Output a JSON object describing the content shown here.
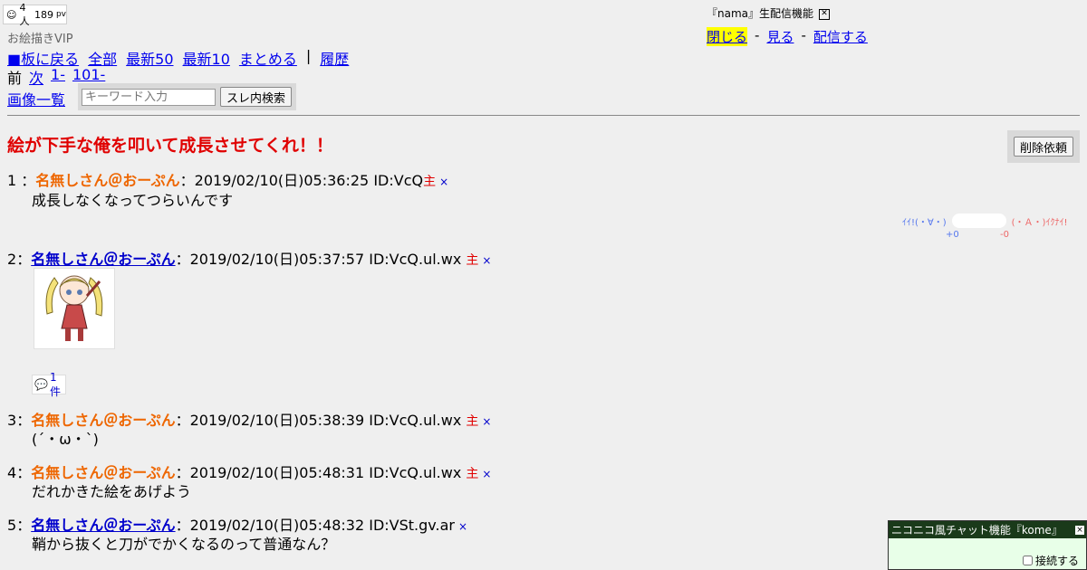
{
  "stats": {
    "count": "4人",
    "views": "189",
    "pv": "pv"
  },
  "board_name": "お絵描きVIP",
  "nav": {
    "back": "■板に戻る",
    "all": "全部",
    "latest50": "最新50",
    "latest10": "最新10",
    "summary": "まとめる",
    "separator": "|",
    "history": "履歴",
    "prev": "前",
    "next": "次",
    "range1": "1-",
    "range2": "101-",
    "images": "画像一覧"
  },
  "search": {
    "placeholder": "キーワード入力",
    "button": "スレ内検索"
  },
  "nama": {
    "title": "『nama』生配信機能",
    "close": "閉じる",
    "watch": "見る",
    "broadcast": "配信する",
    "dash": "-"
  },
  "thread_title": "絵が下手な俺を叩いて成長させてくれ！！",
  "delete_request": "削除依頼",
  "vote": {
    "good": "ｲｲ!(・∀・)",
    "bad": "(・Ａ・)ｲｸﾅｲ!",
    "plus": "+0",
    "minus": "-0"
  },
  "posts": [
    {
      "num": "1",
      "sep": "：",
      "name": "名無しさん＠おーぷん",
      "date": "：2019/02/10(日)05:36:25 ID:VcQ",
      "owner": "主",
      "x": "×",
      "body": "成長しなくなってつらいんです"
    },
    {
      "num": "2",
      "sep": "：",
      "name": "名無しさん＠おーぷん",
      "date": "：2019/02/10(日)05:37:57 ID:VcQ.ul.wx",
      "owner": "主",
      "x": "×",
      "replies": "1件"
    },
    {
      "num": "3",
      "sep": "：",
      "name": "名無しさん＠おーぷん",
      "date": "：2019/02/10(日)05:38:39 ID:VcQ.ul.wx",
      "owner": "主",
      "x": "×",
      "body": "(´・ω・`)"
    },
    {
      "num": "4",
      "sep": "：",
      "name": "名無しさん＠おーぷん",
      "date": "：2019/02/10(日)05:48:31 ID:VcQ.ul.wx",
      "owner": "主",
      "x": "×",
      "body": "だれかきた絵をあげよう"
    },
    {
      "num": "5",
      "sep": "：",
      "name": "名無しさん＠おーぷん",
      "date": "：2019/02/10(日)05:48:32 ID:VSt.gv.ar",
      "x": "×",
      "body": "鞘から抜くと刀がでかくなるのって普通なん？"
    }
  ],
  "chat": {
    "title": "ニコニコ風チャット機能『kome』",
    "close": "×",
    "connect": "接続する"
  },
  "colors": {
    "background": "#efefef",
    "title_red": "#e00000",
    "name_orange": "#ee6600",
    "link_blue": "#0000ee",
    "highlight": "#ffff00",
    "chat_bar": "#1a3a1a"
  }
}
